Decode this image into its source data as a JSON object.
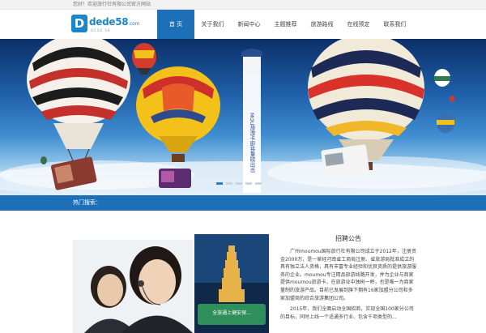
{
  "topbar": {
    "welcome": "您好！欢迎旅行社有限公司官方网站"
  },
  "logo": {
    "mark": "D",
    "word": "dede58",
    "suffix": ".com",
    "sub": "DEDE 58"
  },
  "nav": {
    "items": [
      {
        "label": "首 页",
        "active": true
      },
      {
        "label": "关于我们",
        "active": false
      },
      {
        "label": "新闻中心",
        "active": false
      },
      {
        "label": "主题推荐",
        "active": false
      },
      {
        "label": "旅游路线",
        "active": false
      },
      {
        "label": "在线预定",
        "active": false
      },
      {
        "label": "联系我们",
        "active": false
      }
    ]
  },
  "banner": {
    "flag_text": "MOU旅游卡即将重磅出击",
    "slides": 5,
    "active_slide": 0
  },
  "search": {
    "label": "热门搜索："
  },
  "article": {
    "title": "招聘公告",
    "para1": "广州moumou国际旅行社有限公司成立于2012年，注册资金2000万，是一家经河南省工商局注册、省旅游局批准成立的具有独立法人资格，具有丰富专业经验和优良资质的提供旅游服务的企业。moumou专注精品旅游线路开发，并为企业与商家提供moumou旅游卡，在旅游业中独树一帜，也是唯一为商家量制的旅游产品。目前已发展到旗下拥有16家加盟分公司和多家加盟商的综合旅游集团公司。",
    "para2": "2015年，我们全面启动全国招商，实现全国100家分公司的目标，同时上线一个适通多行业、包含千项类型的..."
  },
  "photo": {
    "poster_text": "全旅通上健安保..."
  },
  "colors": {
    "primary": "#1d6fb8",
    "logo": "#1b86c7"
  }
}
